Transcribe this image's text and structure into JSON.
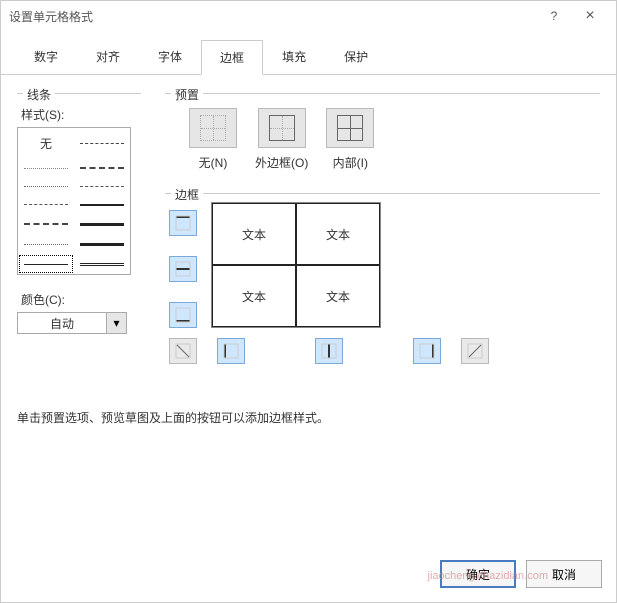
{
  "titlebar": {
    "title": "设置单元格格式",
    "help": "?",
    "close": "×"
  },
  "tabs": [
    "数字",
    "对齐",
    "字体",
    "边框",
    "填充",
    "保护"
  ],
  "active_tab_index": 3,
  "line": {
    "group_label": "线条",
    "style_label": "样式(S):",
    "none_text": "无",
    "color_label": "颜色(C):",
    "color_value": "自动",
    "color_arrow": "▾"
  },
  "preset": {
    "group_label": "预置",
    "items": [
      {
        "label": "无(N)"
      },
      {
        "label": "外边框(O)"
      },
      {
        "label": "内部(I)"
      }
    ]
  },
  "border": {
    "group_label": "边框",
    "sample_text": "文本"
  },
  "hint": "单击预置选项、预览草图及上面的按钮可以添加边框样式。",
  "buttons": {
    "ok": "确定",
    "cancel": "取消"
  },
  "watermark": "jiaocheng.chazidian.com"
}
